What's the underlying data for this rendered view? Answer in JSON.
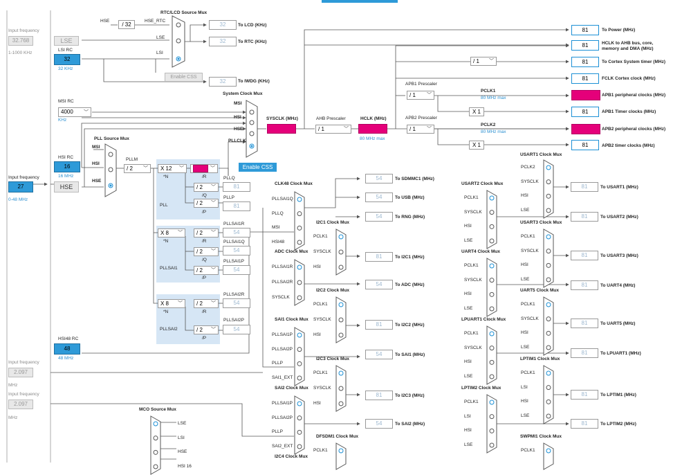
{
  "inputs": {
    "lse_label": "Input frequency",
    "lse_value": "32.768",
    "lse_range": "1-1000 KHz",
    "hse_label": "Input frequency",
    "hse_value": "27",
    "hse_range": "0-48 MHz",
    "ext1_label": "Input frequency",
    "ext1_value": "2.097",
    "ext1_unit": "MHz",
    "ext2_label": "Input frequency",
    "ext2_value": "2.097",
    "ext2_unit": "MHz"
  },
  "sources": {
    "lse": "LSE",
    "hse": "HSE",
    "lsi_title": "LSI RC",
    "lsi_value": "32",
    "lsi_unit": "32 KHz",
    "msi_title": "MSI RC",
    "msi_value": "4000",
    "msi_unit": "KHz",
    "hsi_title": "HSI RC",
    "hsi_value": "16",
    "hsi_unit": "16 MHz",
    "hsi48_title": "HSI48 RC",
    "hsi48_value": "48",
    "hsi48_unit": "48 MHz"
  },
  "rtc": {
    "mux_title": "RTC/LCD Source Mux",
    "hse_label": "HSE",
    "div32": "/ 32",
    "hse_rtc": "HSE_RTC",
    "lse": "LSE",
    "lsi": "LSI",
    "lcd_value": "32",
    "lcd_label": "To LCD (KHz)",
    "rtc_value": "32",
    "rtc_label": "To RTC (KHz)",
    "enable_css": "Enable CSS",
    "iwdg_value": "32",
    "iwdg_label": "To IWDG (KHz)"
  },
  "system": {
    "mux_title": "System Clock Mux",
    "msi": "MSI",
    "hsi": "HSI",
    "hse": "HSE",
    "pllclk": "PLLCLK",
    "enable_css": "Enable CSS",
    "sysclk_label": "SYSCLK (MHz)",
    "sysclk_value": "81",
    "ahb_label": "AHB Prescaler",
    "ahb_value": "/ 1",
    "hclk_label": "HCLK (MHz)",
    "hclk_value": "81",
    "hclk_max": "80 MHz max"
  },
  "outputs": {
    "power_value": "81",
    "power_label": "To Power (MHz)",
    "hclk_ahb_value": "81",
    "hclk_ahb_label": "HCLK to AHB bus, core, memory and DMA (MHz)",
    "cortex_div": "/ 1",
    "cortex_value": "81",
    "cortex_label": "To Cortex System timer (MHz)",
    "fclk_value": "81",
    "fclk_label": "FCLK Cortex clock (MHz)",
    "apb1_presc_label": "APB1 Prescaler",
    "apb1_presc": "/ 1",
    "pclk1": "PCLK1",
    "pclk1_max": "80 MHz max",
    "apb1_value": "81",
    "apb1_label": "APB1 peripheral clocks (MHz)",
    "apb1t_mul": "X 1",
    "apb1t_value": "81",
    "apb1t_label": "APB1 Timer clocks (MHz)",
    "apb2_presc_label": "APB2 Prescaler",
    "apb2_presc": "/ 1",
    "pclk2": "PCLK2",
    "pclk2_max": "80 MHz max",
    "apb2_value": "81",
    "apb2_label": "APB2 peripheral clocks (MHz)",
    "apb2t_mul": "X 1",
    "apb2t_value": "81",
    "apb2t_label": "APB2 timer clocks (MHz)"
  },
  "pll": {
    "mux_title": "PLL Source Mux",
    "msi": "MSI",
    "hsi": "HSI",
    "hse": "HSE",
    "pllm_label": "PLLM",
    "pllm_value": "/ 2",
    "main_n": "X 12",
    "main_n_label": "*N",
    "main_r": "/ 2",
    "main_r_label": "/R",
    "main_q": "/ 2",
    "main_q_label": "/Q",
    "main_p": "/ 2",
    "main_p_label": "/P",
    "main_name": "PLL",
    "pllq": "PLLQ",
    "pllq_value": "81",
    "pllp": "PLLP",
    "pllp_value": "81",
    "sai1_n": "X 8",
    "sai1_n_label": "*N",
    "sai1_r": "/ 2",
    "sai1_r_label": "/R",
    "sai1_q": "/ 2",
    "sai1_q_label": "/Q",
    "sai1_p": "/ 2",
    "sai1_p_label": "/P",
    "sai1_name": "PLLSAI1",
    "pllsai1r": "PLLSAI1R",
    "pllsai1r_value": "54",
    "pllsai1q": "PLLSAI1Q",
    "pllsai1q_value": "54",
    "pllsai1p": "PLLSAI1P",
    "pllsai1p_value": "54",
    "sai2_n": "X 8",
    "sai2_n_label": "*N",
    "sai2_r": "/ 2",
    "sai2_r_label": "/R",
    "sai2_p": "/ 2",
    "sai2_p_label": "/P",
    "sai2_name": "PLLSAI2",
    "pllsai2r": "PLLSAI2R",
    "pllsai2r_value": "54",
    "pllsai2p": "PLLSAI2P",
    "pllsai2p_value": "54"
  },
  "mid": {
    "clk48_title": "CLK48 Clock Mux",
    "clk48_in": [
      "PLLSAI1Q",
      "PLLQ",
      "MSI",
      "HSI48"
    ],
    "sdmmc_value": "54",
    "sdmmc_label": "To SDMMC1 (MHz)",
    "usb_value": "54",
    "usb_label": "To USB (MHz)",
    "rng_value": "54",
    "rng_label": "To RNG (MHz)",
    "adc_title": "ADC Clock Mux",
    "adc_in": [
      "PLLSAI1R",
      "PLLSAI2R",
      "SYSCLK"
    ],
    "adc_value": "54",
    "adc_label": "To ADC (MHz)",
    "i2c1_title": "I2C1 Clock Mux",
    "i2c1_in": [
      "PCLK1",
      "SYSCLK",
      "HSI"
    ],
    "i2c1_value": "81",
    "i2c1_label": "To I2C1 (MHz)",
    "i2c2_title": "I2C2 Clock Mux",
    "i2c2_in": [
      "PCLK1",
      "SYSCLK",
      "HSI"
    ],
    "i2c2_value": "81",
    "i2c2_label": "To I2C2 (MHz)",
    "sai1_title": "SAI1 Clock Mux",
    "sai1_in": [
      "PLLSAI1P",
      "PLLSAI2P",
      "PLLP",
      "SAI1_EXT"
    ],
    "sai1_value": "54",
    "sai1_label": "To SAI1 (MHz)",
    "i2c3_title": "I2C3 Clock Mux",
    "i2c3_in": [
      "PCLK1",
      "SYSCLK",
      "HSI"
    ],
    "i2c3_value": "81",
    "i2c3_label": "To I2C3 (MHz)",
    "sai2_title": "SAI2 Clock Mux",
    "sai2_in": [
      "PLLSAI1P",
      "PLLSAI2P",
      "PLLP",
      "SAI2_EXT"
    ],
    "sai2_value": "54",
    "sai2_label": "To SAI2 (MHz)",
    "dfsdm_title": "DFSDM1 Clock Mux",
    "dfsdm_in": [
      "PCLK1"
    ],
    "i2c4_title": "I2C4 Clock Mux",
    "mco_title": "MCO Source Mux",
    "mco_in": [
      "LSE",
      "LSI",
      "HSE",
      "HSI 16"
    ]
  },
  "right": {
    "usart2_title": "USART2 Clock Mux",
    "usart2_in": [
      "PCLK1",
      "SYSCLK",
      "HSI",
      "LSE"
    ],
    "usart1_title": "USART1 Clock Mux",
    "usart1_in": [
      "PCLK2",
      "SYSCLK",
      "HSI",
      "LSE"
    ],
    "usart1_value": "81",
    "usart1_label": "To USART1 (MHz)",
    "usart2_value": "81",
    "usart2_label": "To USART2 (MHz)",
    "usart3_title": "USART3 Clock Mux",
    "usart3_in": [
      "PCLK1",
      "SYSCLK",
      "HSI",
      "LSE"
    ],
    "usart3_value": "81",
    "usart3_label": "To USART3 (MHz)",
    "uart4_title": "UART4 Clock Mux",
    "uart4_in": [
      "PCLK1",
      "SYSCLK",
      "HSI",
      "LSE"
    ],
    "uart4_value": "81",
    "uart4_label": "To UART4 (MHz)",
    "uart5_title": "UART5 Clock Mux",
    "uart5_in": [
      "PCLK1",
      "SYSCLK",
      "HSI",
      "LSE"
    ],
    "uart5_value": "81",
    "uart5_label": "To UART5 (MHz)",
    "lpuart_title": "LPUART1 Clock Mux",
    "lpuart_in": [
      "PCLK1",
      "SYSCLK",
      "HSI",
      "LSE"
    ],
    "lpuart_value": "81",
    "lpuart_label": "To LPUART1 (MHz)",
    "lptim1_title": "LPTIM1 Clock Mux",
    "lptim1_in": [
      "PCLK1",
      "LSI",
      "HSI",
      "LSE"
    ],
    "lptim1_value": "81",
    "lptim1_label": "To LPTIM1 (MHz)",
    "lptim2_title": "LPTIM2 Clock Mux",
    "lptim2_in": [
      "PCLK1",
      "LSI",
      "HSI",
      "LSE"
    ],
    "lptim2_value": "81",
    "lptim2_label": "To LPTIM2 (MHz)",
    "swpmi_title": "SWPMI1 Clock Mux",
    "swpmi_in": [
      "PCLK1"
    ]
  }
}
